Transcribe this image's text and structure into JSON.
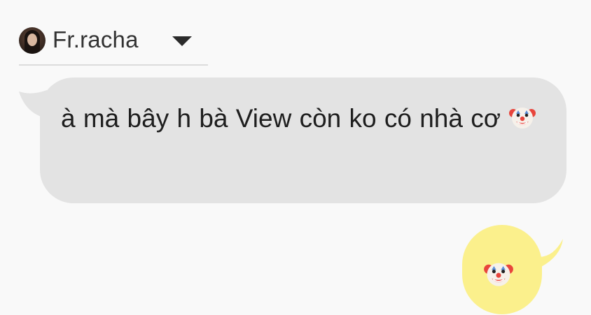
{
  "sender": {
    "name": "Fr.racha",
    "avatar_icon": "user-avatar-photo",
    "menu_icon": "chevron-down-icon"
  },
  "messages": [
    {
      "direction": "incoming",
      "text": "à mà bây h bà View còn ko có nhà cơ",
      "trailing_emoji": "clown-face-emoji",
      "bubble_color": "#e3e3e3"
    },
    {
      "direction": "outgoing",
      "emoji": "clown-face-emoji",
      "bubble_color": "#fbf08c"
    }
  ],
  "colors": {
    "background": "#f9f9f9",
    "incoming_bubble": "#e3e3e3",
    "outgoing_bubble": "#fbf08c",
    "text": "#1e1e1e"
  }
}
